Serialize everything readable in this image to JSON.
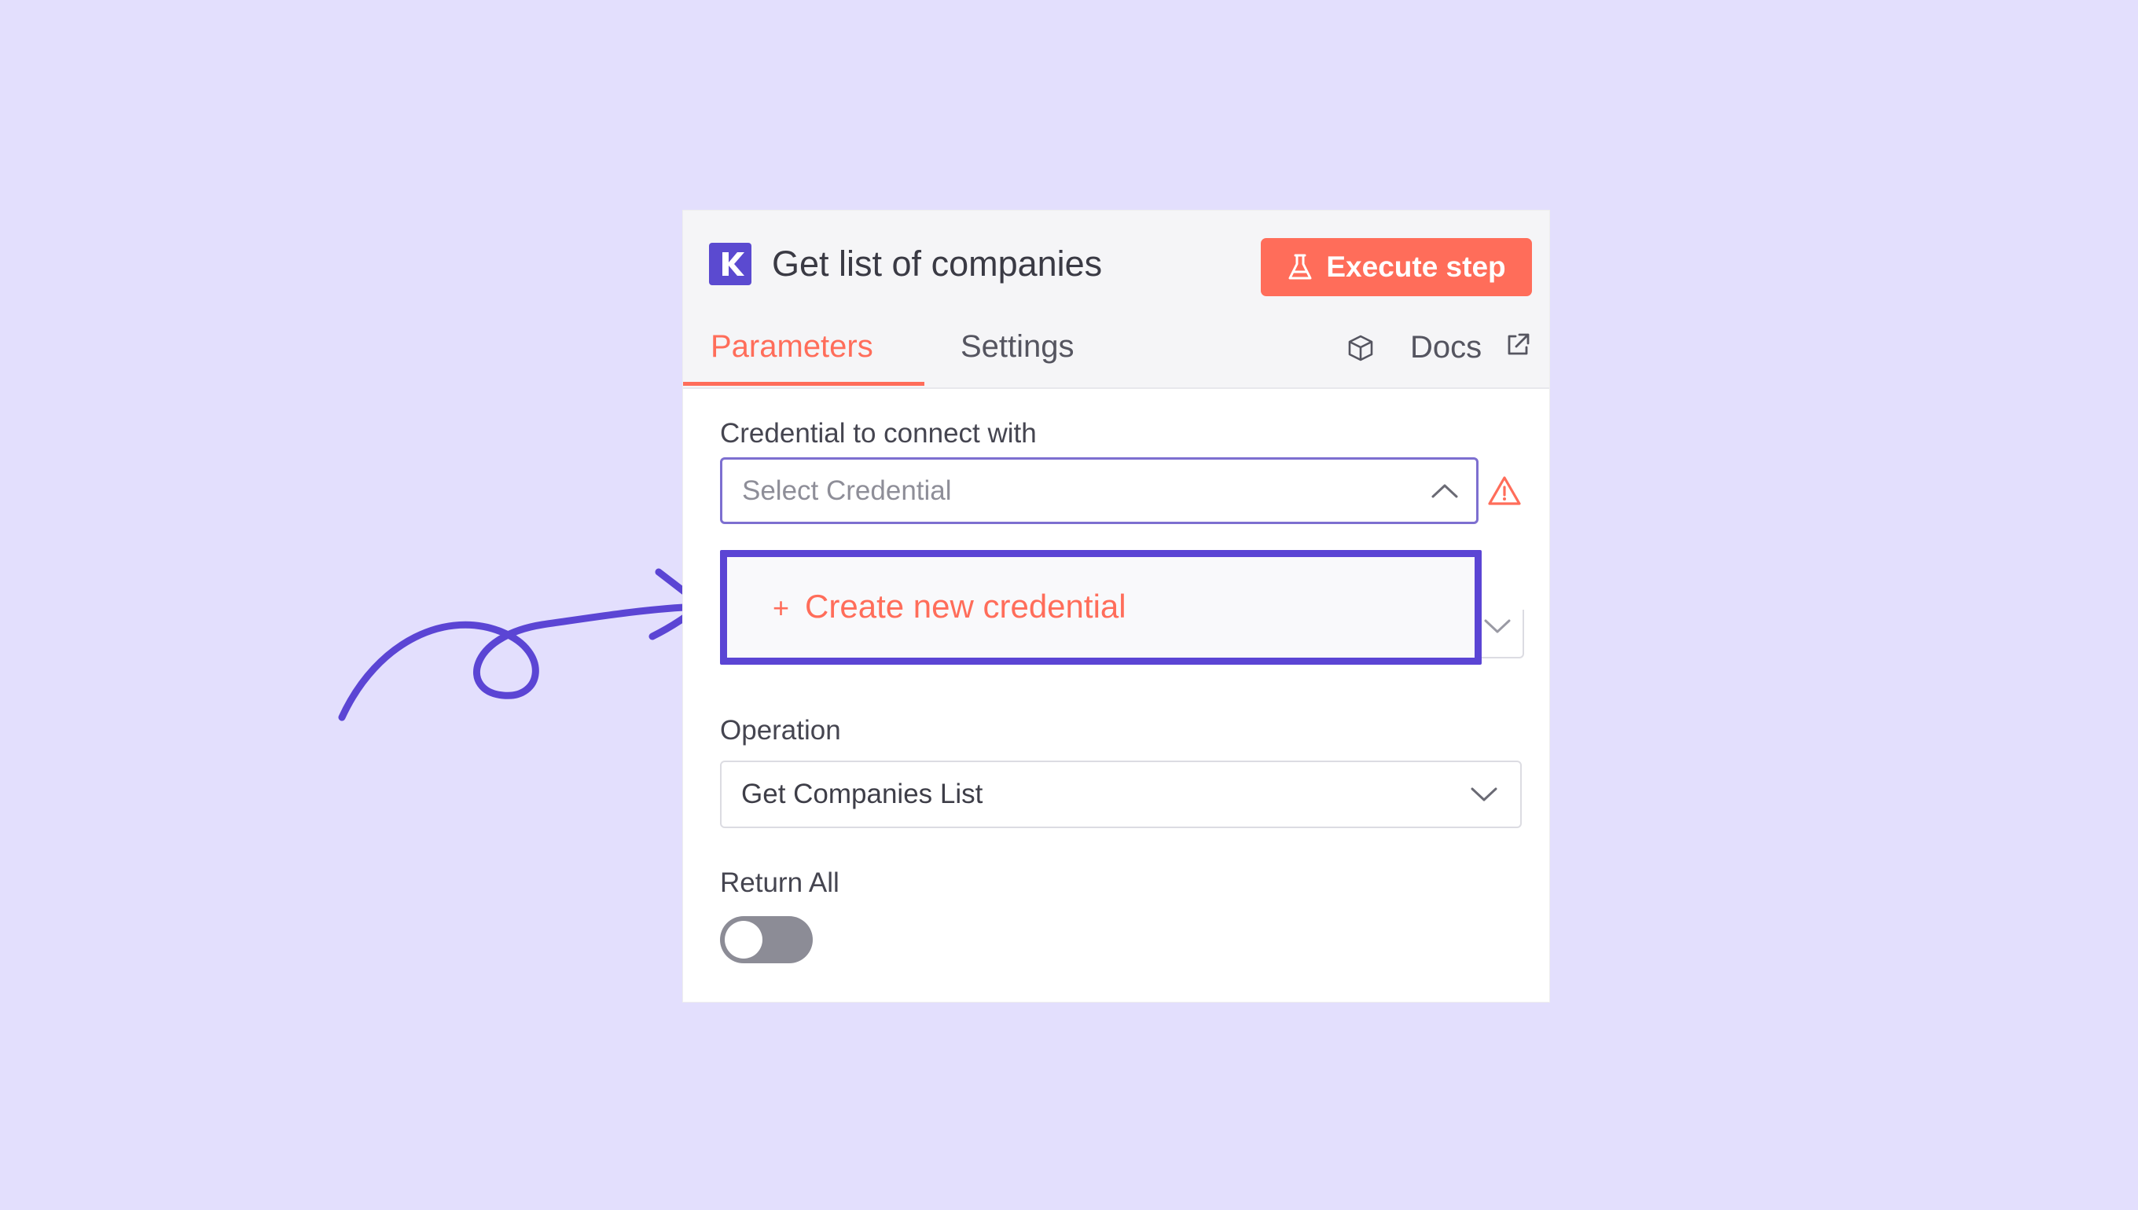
{
  "node": {
    "title": "Get list of companies",
    "logo_icon": "k-logo-icon",
    "execute_label": "Execute step",
    "execute_icon": "flask-icon"
  },
  "tabs": [
    {
      "label": "Parameters",
      "active": true
    },
    {
      "label": "Settings",
      "active": false
    }
  ],
  "docs": {
    "label": "Docs",
    "icons": [
      "cube-icon",
      "external-link-icon"
    ]
  },
  "credential": {
    "label": "Credential to connect with",
    "placeholder": "Select Credential",
    "warning_icon": "warning-triangle-icon",
    "dropdown_open": true
  },
  "dropdown": {
    "create_label": "Create new credential",
    "create_prefix": "+"
  },
  "operation": {
    "label": "Operation",
    "value": "Get Companies List"
  },
  "return_all": {
    "label": "Return All",
    "enabled": false
  },
  "colors": {
    "background": "#e3dffd",
    "accent": "#ff6d5a",
    "highlight": "#5b45d4",
    "brand": "#5b4ad0"
  }
}
